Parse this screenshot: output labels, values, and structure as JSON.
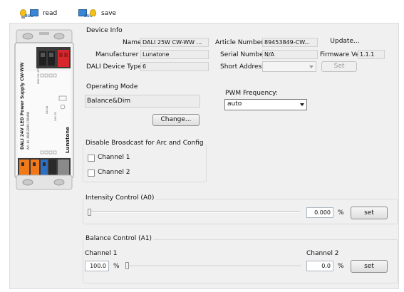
{
  "toolbar": {
    "read_label": "read",
    "save_label": "save",
    "read_icon": "bulb-bus-to-monitor-icon",
    "save_icon": "monitor-bus-to-bulb-icon"
  },
  "device_info": {
    "title": "Device Info",
    "name_label": "Name",
    "name_value": "DALI 25W CW-WW ...",
    "manufacturer_label": "Manufacturer",
    "manufacturer_value": "Lunatone",
    "device_type_label": "DALI Device Type",
    "device_type_value": "6",
    "article_number_label": "Article Number",
    "article_number_value": "89453849-CW...",
    "serial_number_label": "Serial Number",
    "serial_number_value": "N/A",
    "short_address_label": "Short Address",
    "short_address_value": "",
    "update_label": "Update...",
    "firmware_label": "Firmware Ver",
    "firmware_value": "1.1.1",
    "set_label": "Set"
  },
  "operating_mode": {
    "title": "Operating Mode",
    "value": "Balance&Dim",
    "change_label": "Change..."
  },
  "pwm": {
    "label": "PWM Frequency:",
    "selected": "auto"
  },
  "broadcast": {
    "title": "Disable Broadcast  for Arc and Config",
    "channels": [
      {
        "label": "Channel 1",
        "checked": false
      },
      {
        "label": "Channel 2",
        "checked": false
      }
    ]
  },
  "intensity": {
    "title": "Intensity Control (A0)",
    "value": "0.000",
    "unit": "%",
    "set_label": "set",
    "slider_fraction": 0
  },
  "balance": {
    "title": "Balance Control (A1)",
    "channel1_label": "Channel 1",
    "channel1_value": "100.0",
    "channel1_unit": "%",
    "channel2_label": "Channel 2",
    "channel2_value": "0.0",
    "channel2_unit": "%",
    "set_label": "set",
    "slider_fraction": 0
  },
  "device_image": {
    "brand": "Lunatone",
    "product_text": "DALI 24V LED Power Supply CW-WW",
    "article": "Art.-Nr. 89453849-CW-WW",
    "icon": "led-driver-device-icon"
  },
  "colors": {
    "panel_bg": "#f0f0f0",
    "terminal_orange": "#f07a1a",
    "terminal_blue": "#2f6fc0",
    "terminal_red": "#d8262d",
    "terminal_black": "#2a2a2a"
  }
}
